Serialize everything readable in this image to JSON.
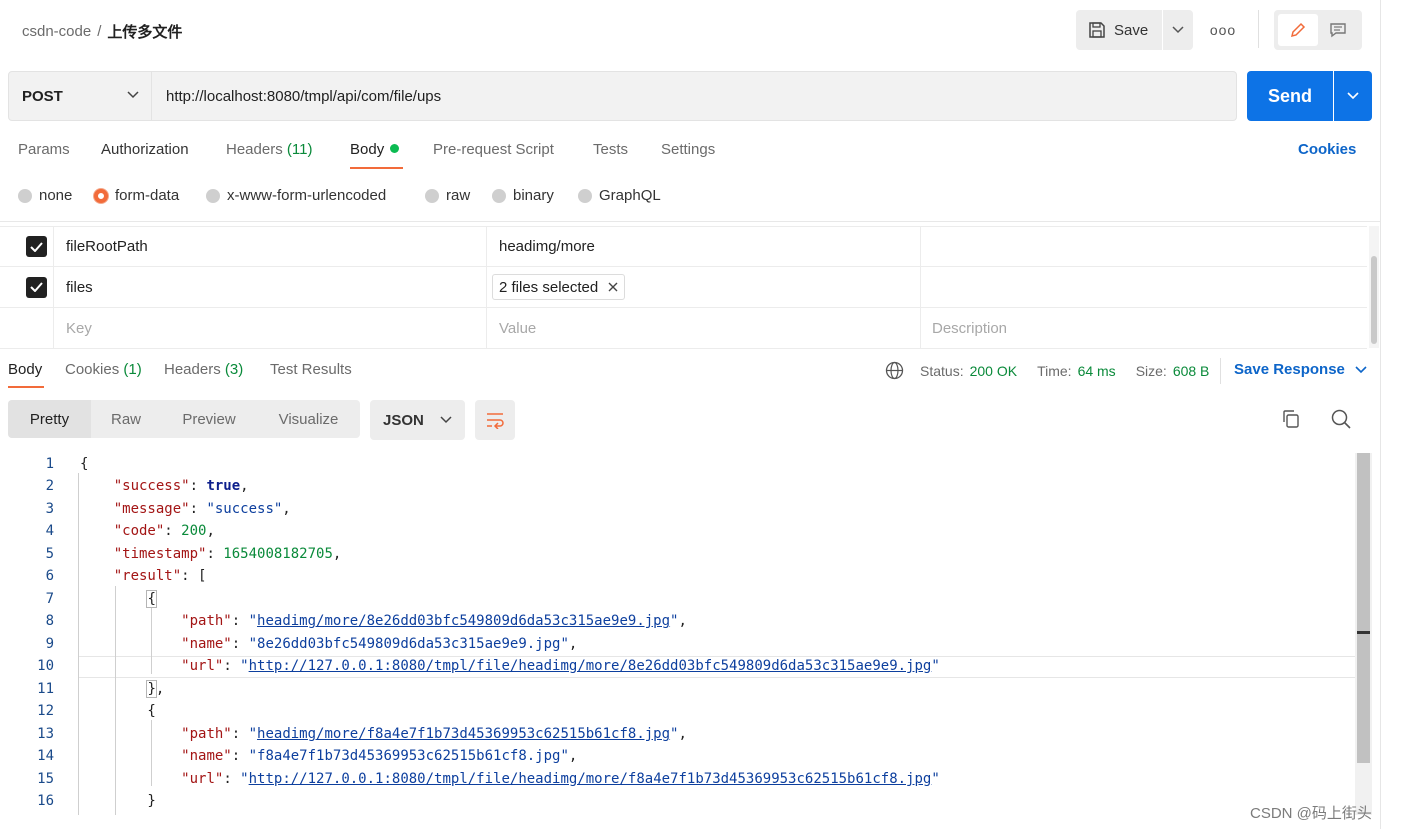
{
  "breadcrumb": {
    "collection": "csdn-code",
    "separator": "/",
    "request": "上传多文件"
  },
  "toolbar": {
    "save_label": "Save",
    "more_label": "ooo"
  },
  "request": {
    "method": "POST",
    "url": "http://localhost:8080/tmpl/api/com/file/ups",
    "send_label": "Send"
  },
  "req_tabs": [
    {
      "label": "Params"
    },
    {
      "label": "Authorization"
    },
    {
      "label": "Headers",
      "count": "(11)"
    },
    {
      "label": "Body"
    },
    {
      "label": "Pre-request Script"
    },
    {
      "label": "Tests"
    },
    {
      "label": "Settings"
    }
  ],
  "cookies_link": "Cookies",
  "body_modes": [
    "none",
    "form-data",
    "x-www-form-urlencoded",
    "raw",
    "binary",
    "GraphQL"
  ],
  "body_mode_selected": "form-data",
  "form_rows": [
    {
      "key": "fileRootPath",
      "value": "headimg/more",
      "checked": true
    },
    {
      "key": "files",
      "value": "2 files selected",
      "checked": true
    }
  ],
  "form_placeholders": {
    "key": "Key",
    "value": "Value",
    "description": "Description"
  },
  "resp_tabs": [
    {
      "label": "Body"
    },
    {
      "label": "Cookies",
      "count": "(1)"
    },
    {
      "label": "Headers",
      "count": "(3)"
    },
    {
      "label": "Test Results"
    }
  ],
  "response_meta": {
    "status_label": "Status:",
    "status_value": "200 OK",
    "time_label": "Time:",
    "time_value": "64 ms",
    "size_label": "Size:",
    "size_value": "608 B",
    "save_response": "Save Response"
  },
  "view_modes": [
    "Pretty",
    "Raw",
    "Preview",
    "Visualize"
  ],
  "format": "JSON",
  "code_line_numbers": [
    "1",
    "2",
    "3",
    "4",
    "5",
    "6",
    "7",
    "8",
    "9",
    "10",
    "11",
    "12",
    "13",
    "14",
    "15",
    "16"
  ],
  "response_json": {
    "success_key": "\"success\"",
    "success_val": "true",
    "message_key": "\"message\"",
    "message_val": "\"success\"",
    "code_key": "\"code\"",
    "code_val": "200",
    "timestamp_key": "\"timestamp\"",
    "timestamp_val": "1654008182705",
    "result_key": "\"result\"",
    "items": [
      {
        "path": "headimg/more/8e26dd03bfc549809d6da53c315ae9e9.jpg",
        "name": "8e26dd03bfc549809d6da53c315ae9e9.jpg",
        "url": "http://127.0.0.1:8080/tmpl/file/headimg/more/8e26dd03bfc549809d6da53c315ae9e9.jpg"
      },
      {
        "path": "headimg/more/f8a4e7f1b73d45369953c62515b61cf8.jpg",
        "name": "f8a4e7f1b73d45369953c62515b61cf8.jpg",
        "url": "http://127.0.0.1:8080/tmpl/file/headimg/more/f8a4e7f1b73d45369953c62515b61cf8.jpg"
      }
    ]
  },
  "watermark": "CSDN @码上街头",
  "colors": {
    "accent": "#f26b3a",
    "send": "#0d73e6",
    "link": "#0d65c9",
    "success": "#0a8a3a"
  }
}
